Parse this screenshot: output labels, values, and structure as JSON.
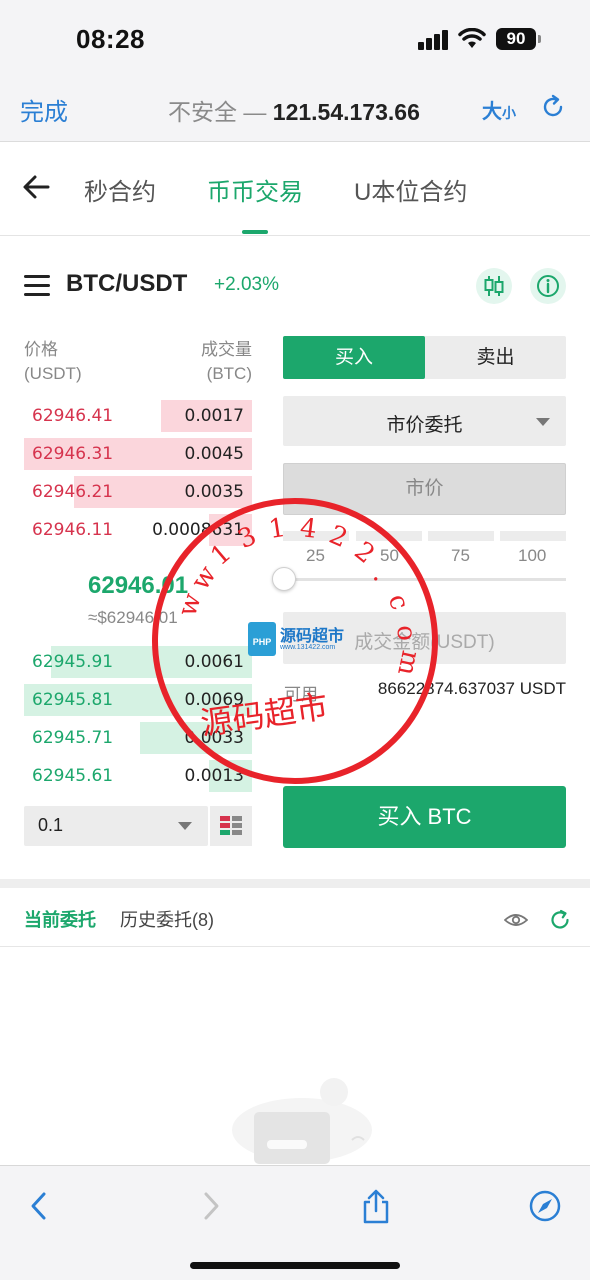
{
  "status_bar": {
    "time": "08:28",
    "battery": "90"
  },
  "browser": {
    "done_label": "完成",
    "url_prefix": "不安全 — ",
    "url_host": "121.54.173.66",
    "size_label": "大",
    "size_small": "小"
  },
  "tabs": [
    {
      "label": "秒合约",
      "active": false
    },
    {
      "label": "币币交易",
      "active": true
    },
    {
      "label": "U本位合约",
      "active": false
    }
  ],
  "pair": {
    "name": "BTC/USDT",
    "change": "+2.03%"
  },
  "order_book": {
    "price_header_1": "价格",
    "price_header_2": "(USDT)",
    "qty_header_1": "成交量",
    "qty_header_2": "(BTC)",
    "asks": [
      {
        "price": "62946.41",
        "qty": "0.0017",
        "depth": 0.4
      },
      {
        "price": "62946.31",
        "qty": "0.0045",
        "depth": 1.0
      },
      {
        "price": "62946.21",
        "qty": "0.0035",
        "depth": 0.78
      },
      {
        "price": "62946.11",
        "qty": "0.0008631",
        "depth": 0.19
      }
    ],
    "last_price": "62946.01",
    "last_price_usd": "≈$62946.01",
    "bids": [
      {
        "price": "62945.91",
        "qty": "0.0061",
        "depth": 0.88
      },
      {
        "price": "62945.81",
        "qty": "0.0069",
        "depth": 1.0
      },
      {
        "price": "62945.71",
        "qty": "0.0033",
        "depth": 0.49
      },
      {
        "price": "62945.61",
        "qty": "0.0013",
        "depth": 0.19
      }
    ],
    "precision_value": "0.1"
  },
  "trade_form": {
    "buy_tab": "买入",
    "sell_tab": "卖出",
    "order_type": "市价委托",
    "price_placeholder": "市价",
    "percent_labels": [
      "25",
      "50",
      "75",
      "100"
    ],
    "slider_value": 0,
    "amount_placeholder": "成交金额(USDT)",
    "available_label": "可用",
    "available_value": "86622874.637037 USDT",
    "buy_button": "买入 BTC"
  },
  "orders": {
    "current_tab": "当前委托",
    "history_tab": "历史委托(8)"
  },
  "watermark": {
    "letters": [
      "w",
      "w",
      "1",
      "3",
      "1",
      "4",
      "2",
      "2",
      ".",
      "c",
      "o",
      "m"
    ],
    "main_text": "源码超市",
    "logo_title": "源码超市",
    "logo_sub": "www.131422.com",
    "logo_badge": "PHP"
  },
  "colors": {
    "accent_green": "#1ca76c",
    "ask_red": "#d6334d",
    "link_blue": "#2b7fd4",
    "stamp_red": "#e8232a"
  }
}
